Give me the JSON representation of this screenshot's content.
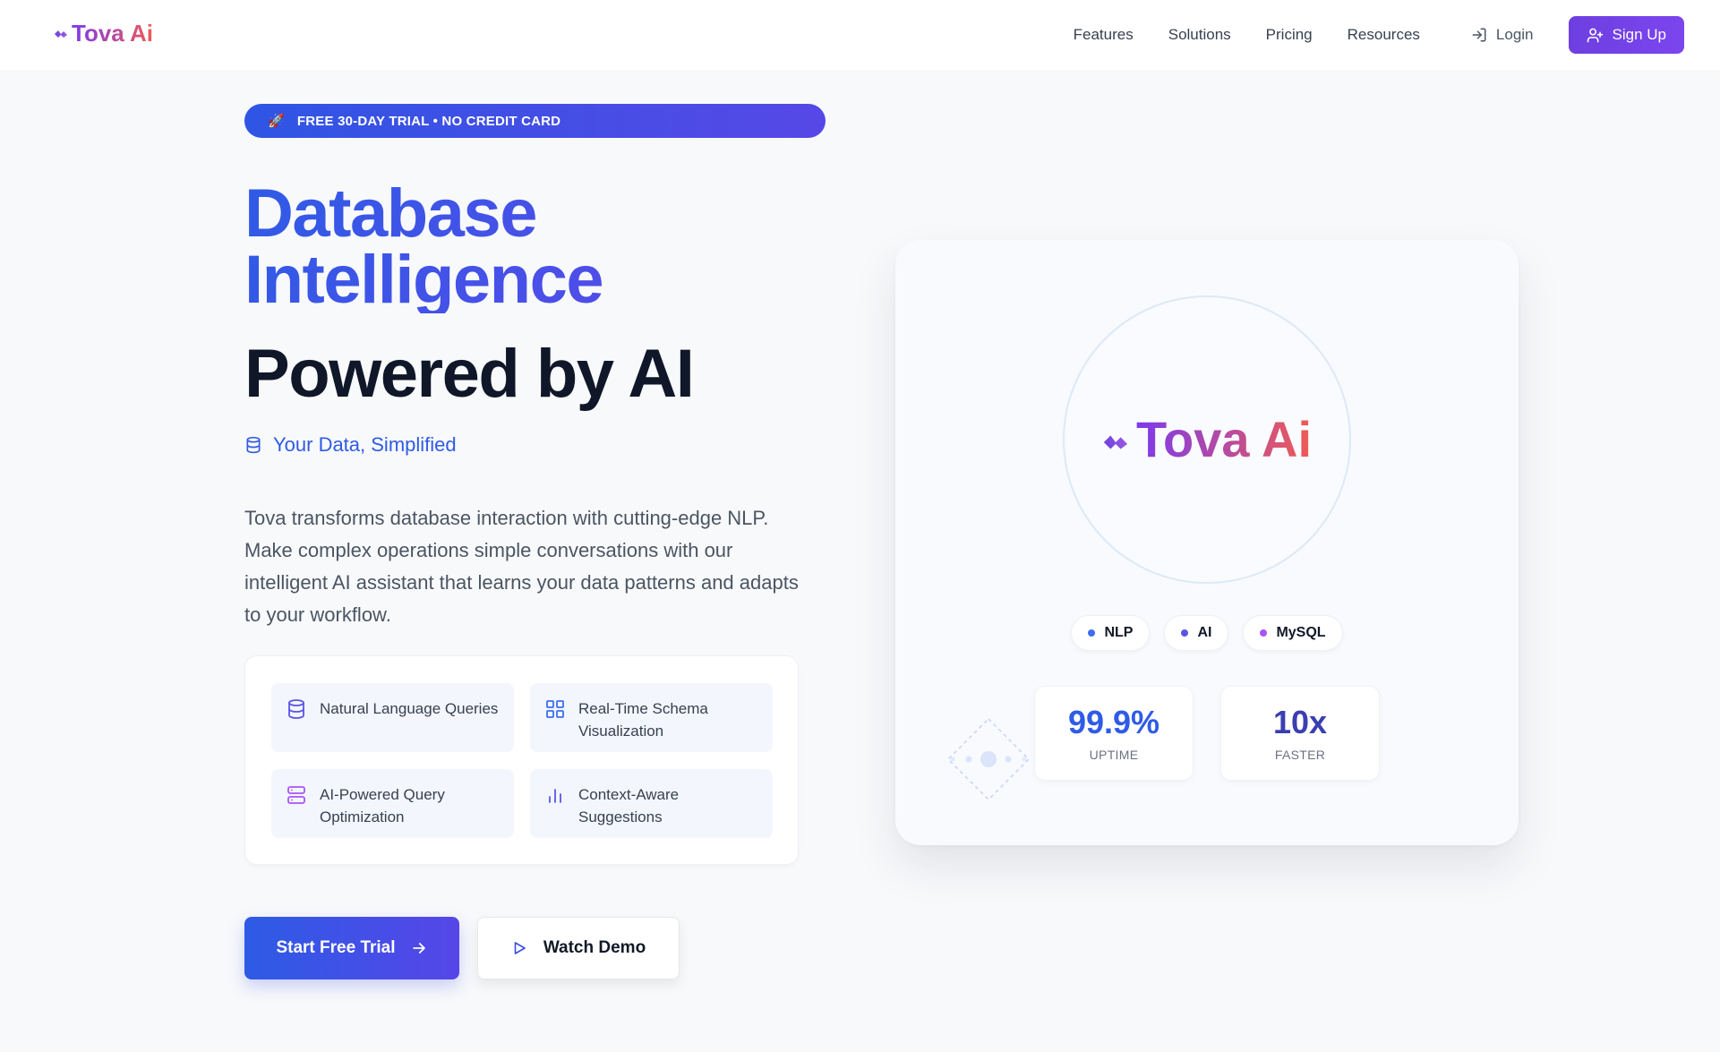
{
  "brand": {
    "name": "Tova Ai"
  },
  "nav": {
    "links": [
      "Features",
      "Solutions",
      "Pricing",
      "Resources"
    ],
    "login_label": "Login",
    "signup_label": "Sign Up"
  },
  "hero": {
    "badge_icon": "rocket-icon",
    "badge_text": "FREE 30-DAY TRIAL • NO CREDIT CARD",
    "title_line_1": "Database",
    "title_line_2": "Intelligence",
    "title_line_3": "Powered by AI",
    "tagline": "Your Data, Simplified",
    "description": "Tova transforms database interaction with cutting-edge NLP. Make complex operations simple conversations with our intelligent AI assistant that learns your data patterns and adapts to your workflow."
  },
  "features": [
    {
      "label": "Natural Language Queries",
      "icon": "database-icon"
    },
    {
      "label": "Real-Time Schema Visualization",
      "icon": "grid-icon"
    },
    {
      "label": "AI-Powered Query Optimization",
      "icon": "server-icon"
    },
    {
      "label": "Context-Aware Suggestions",
      "icon": "bar-chart-icon"
    }
  ],
  "cta": {
    "primary_label": "Start Free Trial",
    "secondary_label": "Watch Demo"
  },
  "panel": {
    "logo_text": "Tova Ai",
    "chips": [
      {
        "label": "NLP",
        "color": "#3b6ff0"
      },
      {
        "label": "AI",
        "color": "#5b55e6"
      },
      {
        "label": "MySQL",
        "color": "#a855f7"
      }
    ],
    "stats": [
      {
        "value": "99.9%",
        "label": "UPTIME",
        "color": "#2f5be6"
      },
      {
        "value": "10x",
        "label": "FASTER",
        "color": "#3b3fb0"
      }
    ]
  },
  "colors": {
    "accent_blue": "#2f5be6",
    "accent_purple": "#6d3fe0",
    "brand_gradient_start": "#7c3aed",
    "brand_gradient_end": "#ef5b55"
  }
}
